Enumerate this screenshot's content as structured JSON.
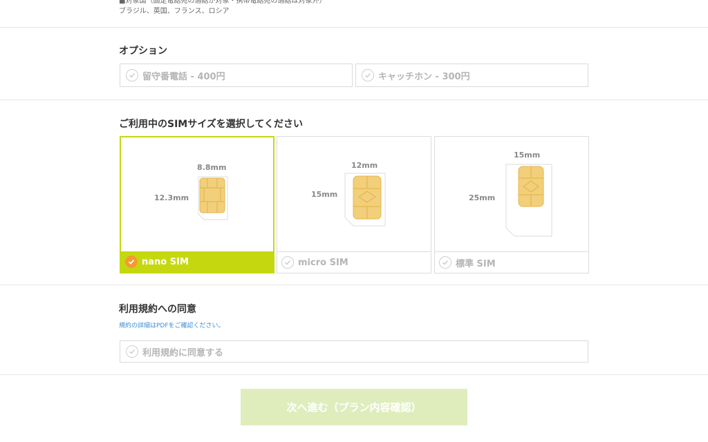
{
  "top_note": {
    "line1": "■対象国（固定電話宛の通話が対象・携帯電話宛の通話は対象外）",
    "line2": "ブラジル、英国、フランス、ロシア"
  },
  "options": {
    "title": "オプション",
    "items": [
      {
        "label": "留守番電話 - 400円"
      },
      {
        "label": "キャッチホン - 300円"
      }
    ]
  },
  "sim": {
    "title": "ご利用中のSIMサイズを選択してください",
    "cards": [
      {
        "label": "nano SIM",
        "width": "8.8mm",
        "height": "12.3mm",
        "selected": true
      },
      {
        "label": "micro SIM",
        "width": "12mm",
        "height": "15mm",
        "selected": false
      },
      {
        "label": "標準 SIM",
        "width": "15mm",
        "height": "25mm",
        "selected": false
      }
    ]
  },
  "terms": {
    "title": "利用規約への同意",
    "note": "規約の詳細はPDFをご確認ください。",
    "agree_label": "利用規約に同意する"
  },
  "next_button": {
    "label": "次へ進む（プラン内容確認）"
  },
  "colors": {
    "accent_green": "#c5d80f",
    "check_orange": "#f39a33",
    "button_disabled": "#dfedbd",
    "link_blue": "#3b8ed6"
  },
  "icons": [
    "check-icon",
    "sim-chip-icon"
  ]
}
